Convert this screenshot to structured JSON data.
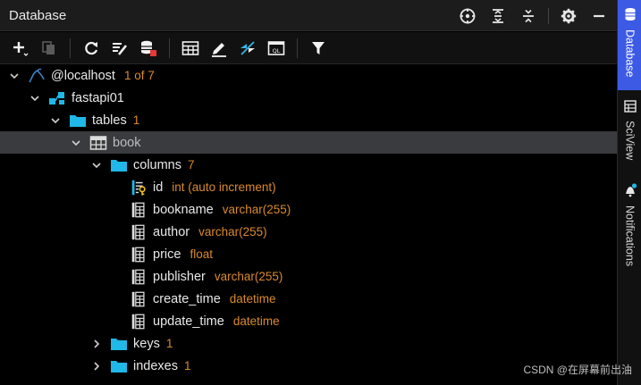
{
  "panel": {
    "title": "Database"
  },
  "title_icons": [
    "crosshair-icon",
    "expand-all-icon",
    "collapse-all-icon",
    "gear-icon",
    "minimize-icon"
  ],
  "toolbar": {
    "buttons": [
      "add-icon",
      "duplicate-icon",
      "refresh-icon",
      "edit-schema-icon",
      "stop-icon",
      "table-view-icon",
      "edit-icon",
      "jump-icon",
      "sql-console-icon",
      "filter-icon"
    ]
  },
  "tree": {
    "host": {
      "label": "@localhost",
      "meta": "1 of 7"
    },
    "schema": {
      "label": "fastapi01"
    },
    "tables": {
      "label": "tables",
      "count": "1"
    },
    "table": {
      "label": "book"
    },
    "columns": {
      "label": "columns",
      "count": "7"
    },
    "column_items": [
      {
        "name": "id",
        "type": "int (auto increment)",
        "key": true
      },
      {
        "name": "bookname",
        "type": "varchar(255)",
        "key": false
      },
      {
        "name": "author",
        "type": "varchar(255)",
        "key": false
      },
      {
        "name": "price",
        "type": "float",
        "key": false
      },
      {
        "name": "publisher",
        "type": "varchar(255)",
        "key": false
      },
      {
        "name": "create_time",
        "type": "datetime",
        "key": false
      },
      {
        "name": "update_time",
        "type": "datetime",
        "key": false
      }
    ],
    "keys": {
      "label": "keys",
      "count": "1"
    },
    "indexes": {
      "label": "indexes",
      "count": "1"
    }
  },
  "side_tabs": {
    "database": "Database",
    "sciview": "SciView",
    "notifications": "Notifications"
  },
  "watermark": "CSDN @在屏幕前出油",
  "colors": {
    "accent": "#3d5ae4",
    "folder": "#1fb8e8",
    "meta": "#d98a2b",
    "selection": "#3a3b3e"
  }
}
